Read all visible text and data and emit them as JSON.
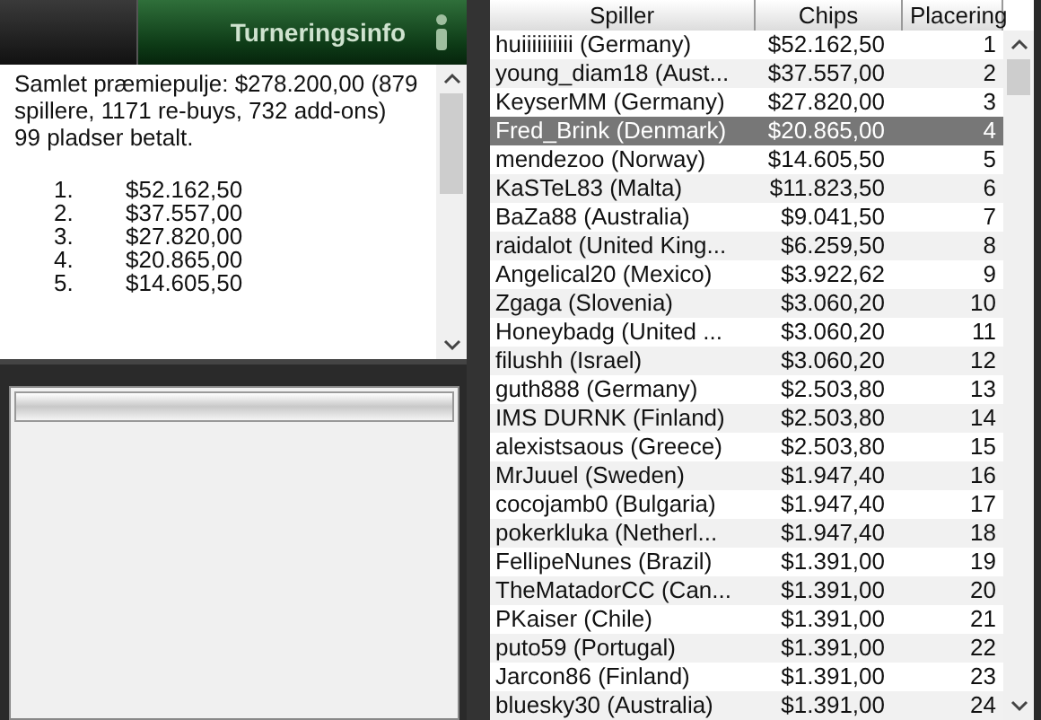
{
  "tabs": [
    {
      "selected": false
    },
    {
      "label": "Turneringsinfo",
      "selected": true
    }
  ],
  "info": {
    "text": "Samlet præmiepulje: $278.200,00 (879 spillere, 1171 re-buys, 732 add-ons)",
    "paid": "99 pladser betalt.",
    "prizes": [
      {
        "rank": "1.",
        "amount": "$52.162,50"
      },
      {
        "rank": "2.",
        "amount": "$37.557,00"
      },
      {
        "rank": "3.",
        "amount": "$27.820,00"
      },
      {
        "rank": "4.",
        "amount": "$20.865,00"
      },
      {
        "rank": "5.",
        "amount": "$14.605,50"
      }
    ]
  },
  "table": {
    "columns": [
      "Spiller",
      "Chips",
      "Placering"
    ],
    "rows": [
      {
        "player": "huiiiiiiiiii (Germany)",
        "chips": "$52.162,50",
        "place": "1",
        "selected": false
      },
      {
        "player": "young_diam18 (Aust...",
        "chips": "$37.557,00",
        "place": "2",
        "selected": false
      },
      {
        "player": "KeyserMM (Germany)",
        "chips": "$27.820,00",
        "place": "3",
        "selected": false
      },
      {
        "player": "Fred_Brink (Denmark)",
        "chips": "$20.865,00",
        "place": "4",
        "selected": true
      },
      {
        "player": "mendezoo (Norway)",
        "chips": "$14.605,50",
        "place": "5",
        "selected": false
      },
      {
        "player": "KaSTeL83 (Malta)",
        "chips": "$11.823,50",
        "place": "6",
        "selected": false
      },
      {
        "player": "BaZa88 (Australia)",
        "chips": "$9.041,50",
        "place": "7",
        "selected": false
      },
      {
        "player": "raidalot (United King...",
        "chips": "$6.259,50",
        "place": "8",
        "selected": false
      },
      {
        "player": "Angelical20 (Mexico)",
        "chips": "$3.922,62",
        "place": "9",
        "selected": false
      },
      {
        "player": "Zgaga (Slovenia)",
        "chips": "$3.060,20",
        "place": "10",
        "selected": false
      },
      {
        "player": "Honeybadg (United ...",
        "chips": "$3.060,20",
        "place": "11",
        "selected": false
      },
      {
        "player": "filushh (Israel)",
        "chips": "$3.060,20",
        "place": "12",
        "selected": false
      },
      {
        "player": "guth888 (Germany)",
        "chips": "$2.503,80",
        "place": "13",
        "selected": false
      },
      {
        "player": "IMS DURNK (Finland)",
        "chips": "$2.503,80",
        "place": "14",
        "selected": false
      },
      {
        "player": "alexistsaous (Greece)",
        "chips": "$2.503,80",
        "place": "15",
        "selected": false
      },
      {
        "player": "MrJuuel (Sweden)",
        "chips": "$1.947,40",
        "place": "16",
        "selected": false
      },
      {
        "player": "cocojamb0 (Bulgaria)",
        "chips": "$1.947,40",
        "place": "17",
        "selected": false
      },
      {
        "player": "pokerkluka (Netherl...",
        "chips": "$1.947,40",
        "place": "18",
        "selected": false
      },
      {
        "player": "FellipeNunes (Brazil)",
        "chips": "$1.391,00",
        "place": "19",
        "selected": false
      },
      {
        "player": "TheMatadorCC (Can...",
        "chips": "$1.391,00",
        "place": "20",
        "selected": false
      },
      {
        "player": "PKaiser (Chile)",
        "chips": "$1.391,00",
        "place": "21",
        "selected": false
      },
      {
        "player": "puto59 (Portugal)",
        "chips": "$1.391,00",
        "place": "22",
        "selected": false
      },
      {
        "player": "Jarcon86 (Finland)",
        "chips": "$1.391,00",
        "place": "23",
        "selected": false
      },
      {
        "player": "bluesky30 (Australia)",
        "chips": "$1.391,00",
        "place": "24",
        "selected": false
      }
    ]
  }
}
